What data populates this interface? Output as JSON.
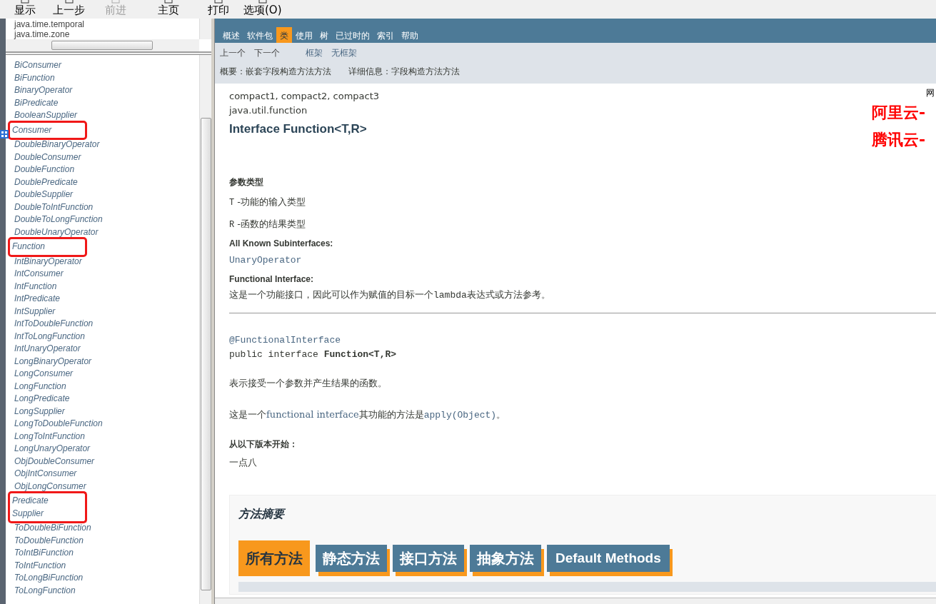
{
  "toolbar": {
    "buttons": [
      {
        "label": "显示",
        "disabled": false
      },
      {
        "label": "上一步",
        "disabled": false
      },
      {
        "label": "前进",
        "disabled": true
      },
      {
        "label": "主页",
        "disabled": false
      },
      {
        "label": "打印",
        "disabled": false
      },
      {
        "label": "选项(O)",
        "disabled": false
      }
    ]
  },
  "packages": [
    "java.time.temporal",
    "java.time.zone"
  ],
  "classes": [
    {
      "name": "BiConsumer",
      "marked": false
    },
    {
      "name": "BiFunction",
      "marked": false
    },
    {
      "name": "BinaryOperator",
      "marked": false
    },
    {
      "name": "BiPredicate",
      "marked": false
    },
    {
      "name": "BooleanSupplier",
      "marked": false
    },
    {
      "name": "Consumer",
      "marked": true
    },
    {
      "name": "DoubleBinaryOperator",
      "marked": false
    },
    {
      "name": "DoubleConsumer",
      "marked": false
    },
    {
      "name": "DoubleFunction",
      "marked": false
    },
    {
      "name": "DoublePredicate",
      "marked": false
    },
    {
      "name": "DoubleSupplier",
      "marked": false
    },
    {
      "name": "DoubleToIntFunction",
      "marked": false
    },
    {
      "name": "DoubleToLongFunction",
      "marked": false
    },
    {
      "name": "DoubleUnaryOperator",
      "marked": false
    },
    {
      "name": "Function",
      "marked": true
    },
    {
      "name": "IntBinaryOperator",
      "marked": false
    },
    {
      "name": "IntConsumer",
      "marked": false
    },
    {
      "name": "IntFunction",
      "marked": false
    },
    {
      "name": "IntPredicate",
      "marked": false
    },
    {
      "name": "IntSupplier",
      "marked": false
    },
    {
      "name": "IntToDoubleFunction",
      "marked": false
    },
    {
      "name": "IntToLongFunction",
      "marked": false
    },
    {
      "name": "IntUnaryOperator",
      "marked": false
    },
    {
      "name": "LongBinaryOperator",
      "marked": false
    },
    {
      "name": "LongConsumer",
      "marked": false
    },
    {
      "name": "LongFunction",
      "marked": false
    },
    {
      "name": "LongPredicate",
      "marked": false
    },
    {
      "name": "LongSupplier",
      "marked": false
    },
    {
      "name": "LongToDoubleFunction",
      "marked": false
    },
    {
      "name": "LongToIntFunction",
      "marked": false
    },
    {
      "name": "LongUnaryOperator",
      "marked": false
    },
    {
      "name": "ObjDoubleConsumer",
      "marked": false
    },
    {
      "name": "ObjIntConsumer",
      "marked": false
    },
    {
      "name": "ObjLongConsumer",
      "marked": false
    },
    {
      "name": "Predicate",
      "marked": true
    },
    {
      "name": "Supplier",
      "marked": true
    },
    {
      "name": "ToDoubleBiFunction",
      "marked": false
    },
    {
      "name": "ToDoubleFunction",
      "marked": false
    },
    {
      "name": "ToIntBiFunction",
      "marked": false
    },
    {
      "name": "ToIntFunction",
      "marked": false
    },
    {
      "name": "ToLongBiFunction",
      "marked": false
    },
    {
      "name": "ToLongFunction",
      "marked": false
    }
  ],
  "nav": {
    "tabs": [
      {
        "label": "概述",
        "selected": false
      },
      {
        "label": "软件包",
        "selected": false
      },
      {
        "label": "类",
        "selected": true
      },
      {
        "label": "使用",
        "selected": false
      },
      {
        "label": "树",
        "selected": false
      },
      {
        "label": "已过时的",
        "selected": false
      },
      {
        "label": "索引",
        "selected": false
      },
      {
        "label": "帮助",
        "selected": false
      }
    ],
    "sub_links": [
      "上一个",
      "下一个",
      "框架",
      "无框架"
    ],
    "summary_line": "概要：嵌套字段构造方法方法",
    "detail_line": "详细信息：字段构造方法方法"
  },
  "ad": {
    "small": "网",
    "lines": [
      "阿里云-",
      "腾讯云-"
    ]
  },
  "doc": {
    "profiles": "compact1, compact2, compact3",
    "package": "java.util.function",
    "title": "Interface Function<T,R>",
    "type_params_label": "参数类型",
    "type_params": [
      {
        "name": "T",
        "desc": "-功能的输入类型"
      },
      {
        "name": "R",
        "desc": "-函数的结果类型"
      }
    ],
    "subinterfaces_label": "All Known Subinterfaces:",
    "subinterfaces": [
      "UnaryOperator"
    ],
    "functional_label": "Functional Interface:",
    "functional_text": [
      {
        "kind": "text",
        "text": "这是一个功能接口，因此可以作为赋值的目标一个"
      },
      {
        "kind": "code",
        "text": "lambda"
      },
      {
        "kind": "text",
        "text": "表达式或方法参考。"
      }
    ],
    "annotation": "@FunctionalInterface",
    "declaration": "public interface **Function<T,R>**",
    "description": "表示接受一个参数并产生结果的函数。",
    "functional_method": [
      {
        "kind": "text",
        "text": "这是一个"
      },
      {
        "kind": "link",
        "text": "functional interface"
      },
      {
        "kind": "text",
        "text": "其功能的方法是"
      },
      {
        "kind": "codelink",
        "text": "apply(Object)"
      },
      {
        "kind": "text",
        "text": "。"
      }
    ],
    "since_label": "从以下版本开始：",
    "since": "一点八"
  },
  "method_summary": {
    "title": "方法摘要",
    "tabs": [
      {
        "label": "所有方法",
        "selected": true
      },
      {
        "label": "静态方法",
        "selected": false
      },
      {
        "label": "接口方法",
        "selected": false
      },
      {
        "label": "抽象方法",
        "selected": false
      },
      {
        "label": "Default Methods",
        "selected": false
      }
    ]
  }
}
